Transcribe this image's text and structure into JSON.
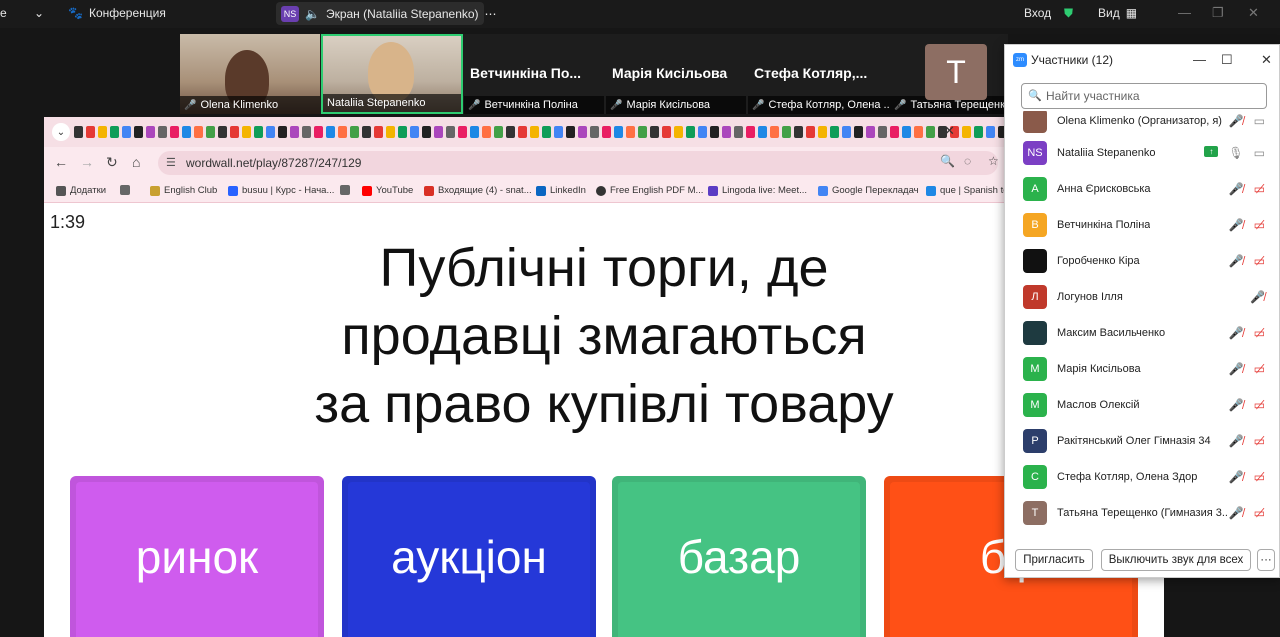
{
  "zoom_bar": {
    "edge_char": "е",
    "conference_label": "Конференция",
    "screen_badge": "NS",
    "screen_label": "Экран (Nataliia Stepanenko)",
    "login_label": "Вход",
    "view_label": "Вид"
  },
  "video_strip": {
    "tiles": [
      {
        "name": "Olena Klimenko"
      },
      {
        "name": "Nataliia Stepanenko"
      },
      {
        "big_name": "Ветчинкіна По...",
        "name": "Ветчинкіна Поліна"
      },
      {
        "big_name": "Марія Кисільова",
        "name": "Марія Кисільова"
      },
      {
        "big_name": "Стефа Котляр,...",
        "name": "Стефа Котляр, Олена ..."
      },
      {
        "avatar": "Т",
        "name": "Татьяна Терещенко"
      }
    ]
  },
  "browser": {
    "url": "wordwall.net/play/87287/247/129",
    "bookmarks": [
      "Додатки",
      "English Club",
      "busuu | Курс - Нача...",
      "YouTube",
      "Входящие (4) - snat...",
      "LinkedIn",
      "Free English PDF M...",
      "Lingoda live: Meet...",
      "Google Перекладач",
      "que | Spanish to"
    ]
  },
  "quiz": {
    "timer": "1:39",
    "question_lines": [
      "Публічні торги, де",
      "продавці змагаються",
      "за право купівлі товару"
    ],
    "answers": [
      {
        "label": "ринок",
        "color": "#c055dc"
      },
      {
        "label": "аукціон",
        "color": "#2234c8"
      },
      {
        "label": "базар",
        "color": "#40b579"
      },
      {
        "label": "бір",
        "color": "#ee4a14"
      }
    ]
  },
  "participants": {
    "title": "Участники (12)",
    "search_placeholder": "Найти участника",
    "list": [
      {
        "initial": "",
        "name": "Olena Klimenko (Организатор, я)",
        "color": "#8a5a4a"
      },
      {
        "initial": "NS",
        "name": "Nataliia Stepanenko",
        "color": "#7b3fc4"
      },
      {
        "initial": "А",
        "name": "Анна Єрисковська",
        "color": "#2bb24c"
      },
      {
        "initial": "В",
        "name": "Ветчинкіна Поліна",
        "color": "#f5a623"
      },
      {
        "initial": "",
        "name": "Горобченко Кіра",
        "color": "#111111"
      },
      {
        "initial": "Л",
        "name": "Логунов Ілля",
        "color": "#c0392b"
      },
      {
        "initial": "",
        "name": "Максим Васильченко",
        "color": "#1e3a40"
      },
      {
        "initial": "М",
        "name": "Марія Кисільова",
        "color": "#2bb24c"
      },
      {
        "initial": "М",
        "name": "Маслов Олексій",
        "color": "#2bb24c"
      },
      {
        "initial": "Р",
        "name": "Ракітянський Олег Гімназія 34",
        "color": "#2c3e6b"
      },
      {
        "initial": "С",
        "name": "Стефа Котляр, Олена Здор",
        "color": "#2bb24c"
      },
      {
        "initial": "Т",
        "name": "Татьяна Терещенко (Гимназия 3...",
        "color": "#8d6e63"
      }
    ],
    "invite_label": "Пригласить",
    "mute_all_label": "Выключить звук для всех",
    "more_label": "···"
  }
}
